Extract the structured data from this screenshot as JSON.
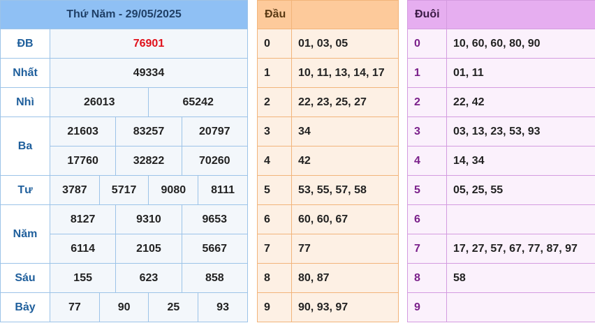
{
  "results": {
    "title": "Thứ Năm - 29/05/2025",
    "prizes": [
      {
        "label": "ĐB",
        "values": [
          "76901"
        ]
      },
      {
        "label": "Nhất",
        "values": [
          "49334"
        ]
      },
      {
        "label": "Nhì",
        "values": [
          "26013",
          "65242"
        ]
      },
      {
        "label": "Ba",
        "values": [
          "21603",
          "83257",
          "20797",
          "17760",
          "32822",
          "70260"
        ]
      },
      {
        "label": "Tư",
        "values": [
          "3787",
          "5717",
          "9080",
          "8111"
        ]
      },
      {
        "label": "Năm",
        "values": [
          "8127",
          "9310",
          "9653",
          "6114",
          "2105",
          "5667"
        ]
      },
      {
        "label": "Sáu",
        "values": [
          "155",
          "623",
          "858"
        ]
      },
      {
        "label": "Bảy",
        "values": [
          "77",
          "90",
          "25",
          "93"
        ]
      }
    ]
  },
  "dau": {
    "header": "Đầu",
    "rows": [
      {
        "k": "0",
        "v": "01, 03, 05"
      },
      {
        "k": "1",
        "v": "10, 11, 13, 14, 17"
      },
      {
        "k": "2",
        "v": "22, 23, 25, 27"
      },
      {
        "k": "3",
        "v": "34"
      },
      {
        "k": "4",
        "v": "42"
      },
      {
        "k": "5",
        "v": "53, 55, 57, 58"
      },
      {
        "k": "6",
        "v": "60, 60, 67"
      },
      {
        "k": "7",
        "v": "77"
      },
      {
        "k": "8",
        "v": "80, 87"
      },
      {
        "k": "9",
        "v": "90, 93, 97"
      }
    ]
  },
  "duoi": {
    "header": "Đuôi",
    "rows": [
      {
        "k": "0",
        "v": "10, 60, 60, 80, 90"
      },
      {
        "k": "1",
        "v": "01, 11"
      },
      {
        "k": "2",
        "v": "22, 42"
      },
      {
        "k": "3",
        "v": "03, 13, 23, 53, 93"
      },
      {
        "k": "4",
        "v": "14, 34"
      },
      {
        "k": "5",
        "v": "05, 25, 55"
      },
      {
        "k": "6",
        "v": ""
      },
      {
        "k": "7",
        "v": "17, 27, 57, 67, 77, 87, 97"
      },
      {
        "k": "8",
        "v": "58"
      },
      {
        "k": "9",
        "v": ""
      }
    ]
  }
}
